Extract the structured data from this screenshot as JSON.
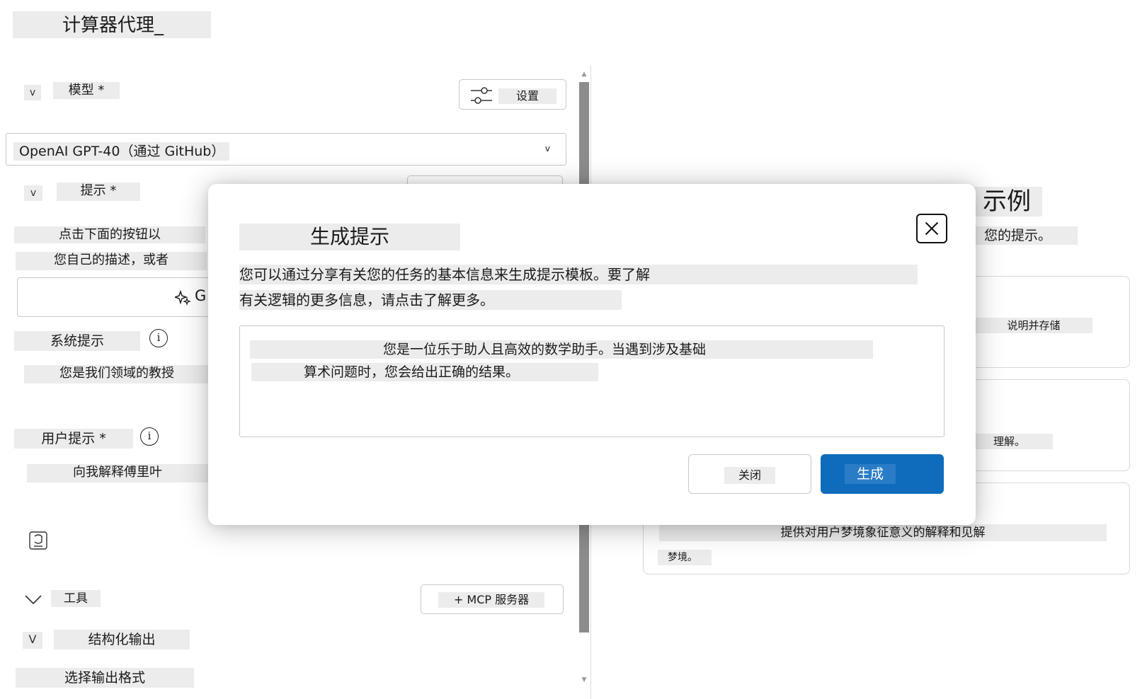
{
  "app": {
    "title": "计算器代理_"
  },
  "model_section": {
    "chevron": "v",
    "label": "模型 *",
    "settings_label": "设置",
    "selected_model": "OpenAI GPT-40（通过 GitHub）",
    "select_arrow": "v"
  },
  "prompt_section": {
    "chevron": "v",
    "label": "提示 *",
    "hint_line1": "点击下面的按钮以",
    "hint_line2": "您自己的描述，或者",
    "generate_partial": "G"
  },
  "system_prompt": {
    "label": "系统提示",
    "info_glyph": "i",
    "value": "您是我们领域的教授"
  },
  "user_prompt": {
    "label": "用户提示 *",
    "info_glyph": "i",
    "value": "向我解释傅里叶"
  },
  "tools": {
    "chevron": "v",
    "label": "工具",
    "mcp_button": "+ MCP 服务器"
  },
  "structured_output": {
    "chevron": "V",
    "label": "结构化输出",
    "format_label": "选择输出格式"
  },
  "examples": {
    "title": "示例",
    "subtitle": "您的提示。",
    "cards": [
      {
        "text": "说明并存储"
      },
      {
        "text": "理解。"
      },
      {
        "text": "提供对用户梦境象征意义的解释和见解",
        "sub": "梦境。"
      }
    ]
  },
  "modal": {
    "title": "生成提示",
    "description_line1": "您可以通过分享有关您的任务的基本信息来生成提示模板。要了解",
    "description_line2": "有关逻辑的更多信息，请点击了解更多。",
    "textarea_line1": "您是一位乐于助人且高效的数学助手。当遇到涉及基础",
    "textarea_line2": "算术问题时，您会给出正确的结果。",
    "close_label": "关闭",
    "generate_label": "生成"
  },
  "colors": {
    "accent": "#0f6cbd",
    "highlight": "#ececec",
    "scrollbar": "#8c8c8c"
  },
  "icons": [
    "sliders-icon",
    "sparkle-icon",
    "info-icon",
    "attach-icon",
    "chevron-down-icon",
    "close-icon"
  ]
}
